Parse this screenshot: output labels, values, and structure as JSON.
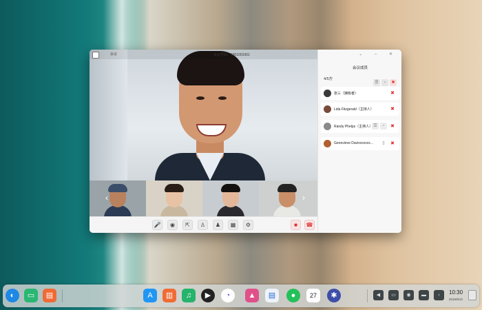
{
  "window": {
    "room_label": "会议",
    "meeting_id": "会议号码：1801001001"
  },
  "panel": {
    "title": "会议成员",
    "count": "4/5方",
    "members": [
      {
        "name": "张三（拥有者）",
        "avatar_color": "#3a3a3a"
      },
      {
        "name": "Lida Fitzgerald（主持人）",
        "avatar_color": "#7a4a3a"
      },
      {
        "name": "Randy Phelps（主持人）",
        "avatar_color": "#8a8a8a"
      },
      {
        "name": "Genevieve Davixxxxxxx...",
        "avatar_color": "#b06030"
      }
    ]
  },
  "controls": {
    "icons": [
      "microphone-icon",
      "camera-icon",
      "share-screen-icon",
      "add-user-icon",
      "user-icon",
      "grid-layout-icon",
      "settings-icon"
    ]
  },
  "dock": {
    "time": "10:30",
    "date": "2016/9/12",
    "calendar_day": "27"
  },
  "colors": {
    "accent_red": "#e02d2d"
  }
}
